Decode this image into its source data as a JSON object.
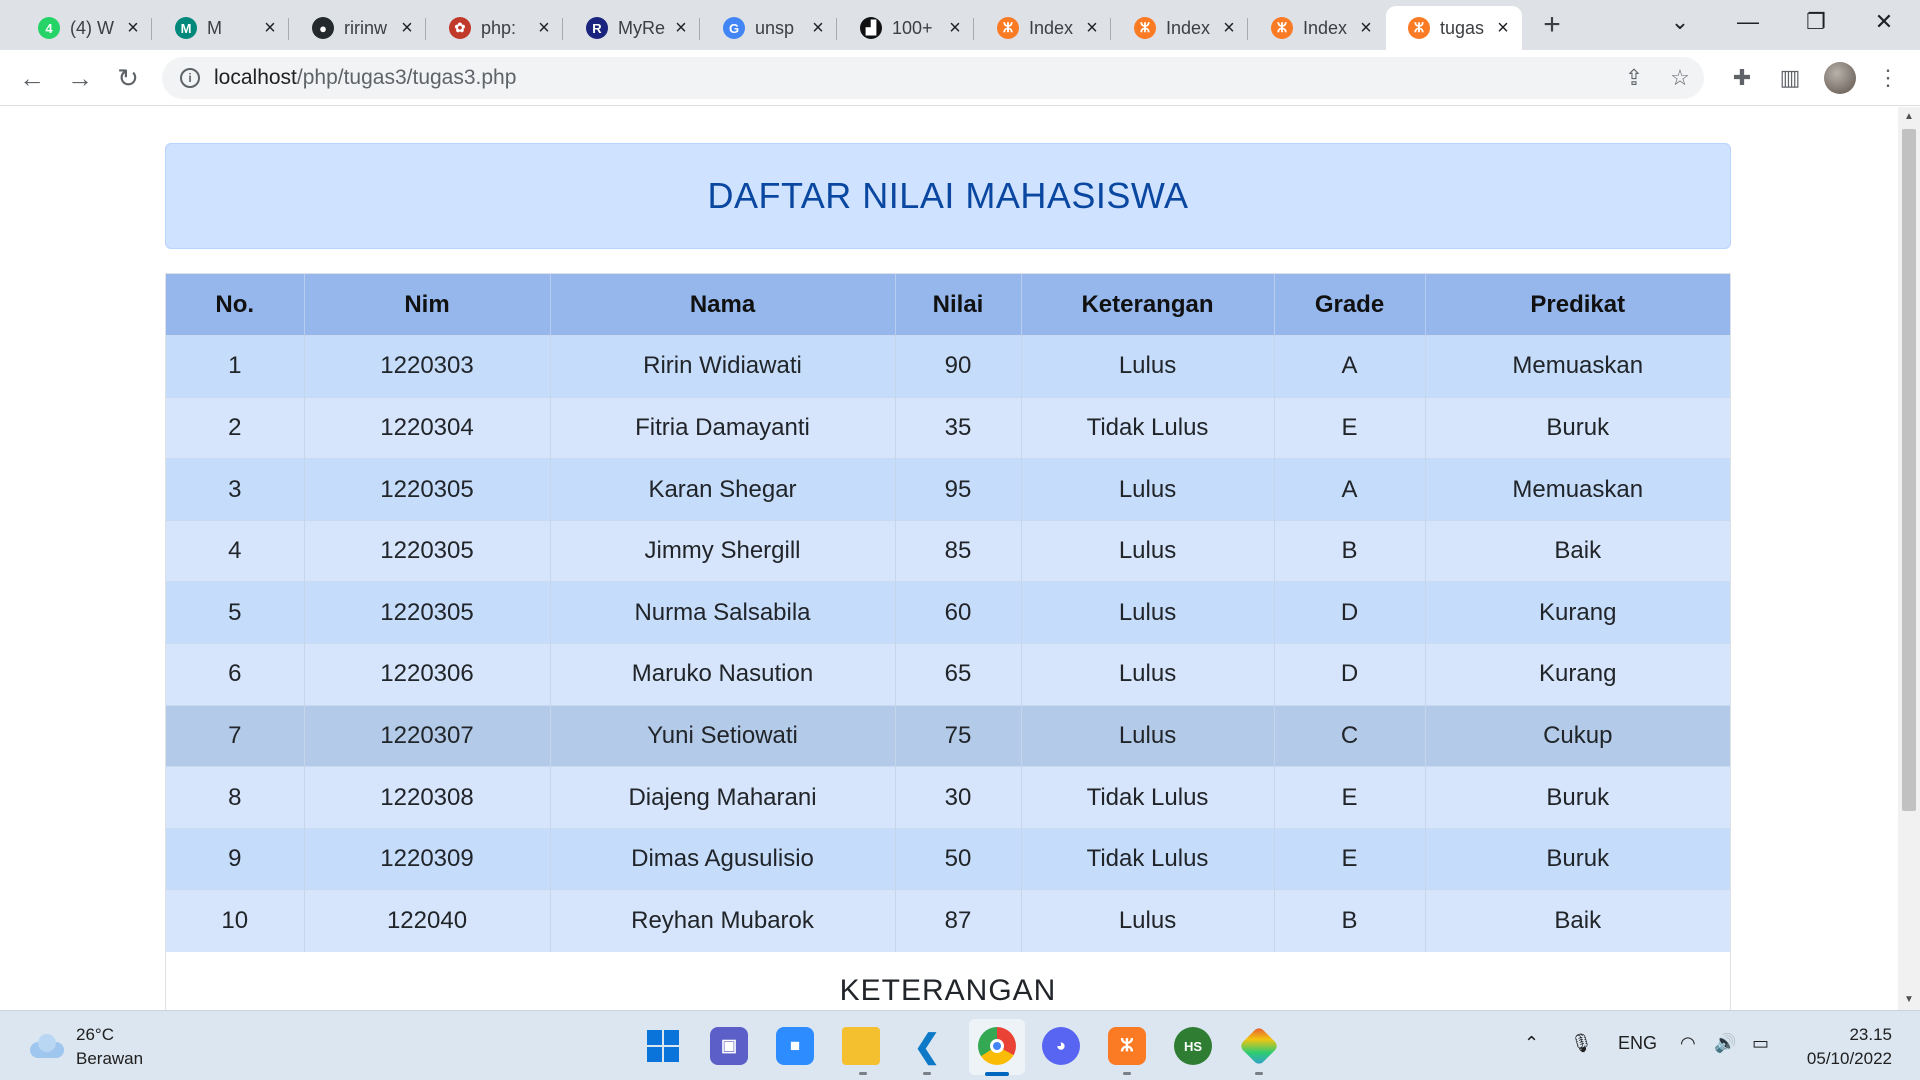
{
  "browser": {
    "tabs": [
      {
        "title": "(4) W",
        "icon": "whatsapp-icon",
        "color": "#25d366",
        "glyph": "4"
      },
      {
        "title": "M",
        "icon": "google-meet-icon",
        "color": "#00897b",
        "glyph": "M"
      },
      {
        "title": "ririnw",
        "icon": "github-icon",
        "color": "#24292e",
        "glyph": "●"
      },
      {
        "title": "php:",
        "icon": "php-icon",
        "color": "#c0392b",
        "glyph": "✿"
      },
      {
        "title": "MyRe",
        "icon": "myrepublic-icon",
        "color": "#1a237e",
        "glyph": "R"
      },
      {
        "title": "unsp",
        "icon": "google-icon",
        "color": "#4285f4",
        "glyph": "G"
      },
      {
        "title": "100+",
        "icon": "unsplash-icon",
        "color": "#111111",
        "glyph": "▟"
      },
      {
        "title": "Index",
        "icon": "xampp-icon",
        "color": "#fb7a24",
        "glyph": "ⵣ"
      },
      {
        "title": "Index",
        "icon": "xampp-icon",
        "color": "#fb7a24",
        "glyph": "ⵣ"
      },
      {
        "title": "Index",
        "icon": "xampp-icon",
        "color": "#fb7a24",
        "glyph": "ⵣ"
      },
      {
        "title": "tugas",
        "icon": "xampp-icon",
        "color": "#fb7a24",
        "glyph": "ⵣ"
      }
    ],
    "url_host": "localhost",
    "url_path": "/php/tugas3/tugas3.php"
  },
  "page": {
    "title": "DAFTAR NILAI MAHASISWA",
    "section_title": "KETERANGAN"
  },
  "table": {
    "headers": [
      "No.",
      "Nim",
      "Nama",
      "Nilai",
      "Keterangan",
      "Grade",
      "Predikat"
    ],
    "rows": [
      [
        "1",
        "1220303",
        "Ririn Widiawati",
        "90",
        "Lulus",
        "A",
        "Memuaskan"
      ],
      [
        "2",
        "1220304",
        "Fitria Damayanti",
        "35",
        "Tidak Lulus",
        "E",
        "Buruk"
      ],
      [
        "3",
        "1220305",
        "Karan Shegar",
        "95",
        "Lulus",
        "A",
        "Memuaskan"
      ],
      [
        "4",
        "1220305",
        "Jimmy Shergill",
        "85",
        "Lulus",
        "B",
        "Baik"
      ],
      [
        "5",
        "1220305",
        "Nurma Salsabila",
        "60",
        "Lulus",
        "D",
        "Kurang"
      ],
      [
        "6",
        "1220306",
        "Maruko Nasution",
        "65",
        "Lulus",
        "D",
        "Kurang"
      ],
      [
        "7",
        "1220307",
        "Yuni Setiowati",
        "75",
        "Lulus",
        "C",
        "Cukup"
      ],
      [
        "8",
        "1220308",
        "Diajeng Maharani",
        "30",
        "Tidak Lulus",
        "E",
        "Buruk"
      ],
      [
        "9",
        "1220309",
        "Dimas Agusulisio",
        "50",
        "Tidak Lulus",
        "E",
        "Buruk"
      ],
      [
        "10",
        "122040",
        "Reyhan Mubarok",
        "87",
        "Lulus",
        "B",
        "Baik"
      ]
    ]
  },
  "taskbar": {
    "temperature": "26°C",
    "weather": "Berawan",
    "language": "ENG",
    "time": "23.15",
    "date": "05/10/2022",
    "hs_label": "HS"
  }
}
